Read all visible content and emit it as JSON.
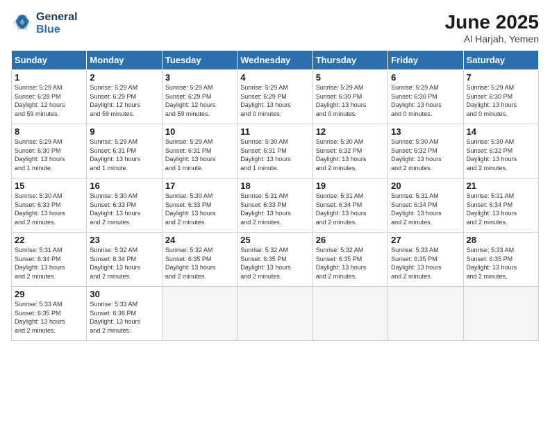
{
  "logo": {
    "line1": "General",
    "line2": "Blue"
  },
  "title": "June 2025",
  "location": "Al Harjah, Yemen",
  "days_of_week": [
    "Sunday",
    "Monday",
    "Tuesday",
    "Wednesday",
    "Thursday",
    "Friday",
    "Saturday"
  ],
  "weeks": [
    [
      {
        "day": "1",
        "info": "Sunrise: 5:29 AM\nSunset: 6:28 PM\nDaylight: 12 hours\nand 59 minutes."
      },
      {
        "day": "2",
        "info": "Sunrise: 5:29 AM\nSunset: 6:29 PM\nDaylight: 12 hours\nand 59 minutes."
      },
      {
        "day": "3",
        "info": "Sunrise: 5:29 AM\nSunset: 6:29 PM\nDaylight: 12 hours\nand 59 minutes."
      },
      {
        "day": "4",
        "info": "Sunrise: 5:29 AM\nSunset: 6:29 PM\nDaylight: 13 hours\nand 0 minutes."
      },
      {
        "day": "5",
        "info": "Sunrise: 5:29 AM\nSunset: 6:30 PM\nDaylight: 13 hours\nand 0 minutes."
      },
      {
        "day": "6",
        "info": "Sunrise: 5:29 AM\nSunset: 6:30 PM\nDaylight: 13 hours\nand 0 minutes."
      },
      {
        "day": "7",
        "info": "Sunrise: 5:29 AM\nSunset: 6:30 PM\nDaylight: 13 hours\nand 0 minutes."
      }
    ],
    [
      {
        "day": "8",
        "info": "Sunrise: 5:29 AM\nSunset: 6:30 PM\nDaylight: 13 hours\nand 1 minute."
      },
      {
        "day": "9",
        "info": "Sunrise: 5:29 AM\nSunset: 6:31 PM\nDaylight: 13 hours\nand 1 minute."
      },
      {
        "day": "10",
        "info": "Sunrise: 5:29 AM\nSunset: 6:31 PM\nDaylight: 13 hours\nand 1 minute."
      },
      {
        "day": "11",
        "info": "Sunrise: 5:30 AM\nSunset: 6:31 PM\nDaylight: 13 hours\nand 1 minute."
      },
      {
        "day": "12",
        "info": "Sunrise: 5:30 AM\nSunset: 6:32 PM\nDaylight: 13 hours\nand 2 minutes."
      },
      {
        "day": "13",
        "info": "Sunrise: 5:30 AM\nSunset: 6:32 PM\nDaylight: 13 hours\nand 2 minutes."
      },
      {
        "day": "14",
        "info": "Sunrise: 5:30 AM\nSunset: 6:32 PM\nDaylight: 13 hours\nand 2 minutes."
      }
    ],
    [
      {
        "day": "15",
        "info": "Sunrise: 5:30 AM\nSunset: 6:33 PM\nDaylight: 13 hours\nand 2 minutes."
      },
      {
        "day": "16",
        "info": "Sunrise: 5:30 AM\nSunset: 6:33 PM\nDaylight: 13 hours\nand 2 minutes."
      },
      {
        "day": "17",
        "info": "Sunrise: 5:30 AM\nSunset: 6:33 PM\nDaylight: 13 hours\nand 2 minutes."
      },
      {
        "day": "18",
        "info": "Sunrise: 5:31 AM\nSunset: 6:33 PM\nDaylight: 13 hours\nand 2 minutes."
      },
      {
        "day": "19",
        "info": "Sunrise: 5:31 AM\nSunset: 6:34 PM\nDaylight: 13 hours\nand 2 minutes."
      },
      {
        "day": "20",
        "info": "Sunrise: 5:31 AM\nSunset: 6:34 PM\nDaylight: 13 hours\nand 2 minutes."
      },
      {
        "day": "21",
        "info": "Sunrise: 5:31 AM\nSunset: 6:34 PM\nDaylight: 13 hours\nand 2 minutes."
      }
    ],
    [
      {
        "day": "22",
        "info": "Sunrise: 5:31 AM\nSunset: 6:34 PM\nDaylight: 13 hours\nand 2 minutes."
      },
      {
        "day": "23",
        "info": "Sunrise: 5:32 AM\nSunset: 6:34 PM\nDaylight: 13 hours\nand 2 minutes."
      },
      {
        "day": "24",
        "info": "Sunrise: 5:32 AM\nSunset: 6:35 PM\nDaylight: 13 hours\nand 2 minutes."
      },
      {
        "day": "25",
        "info": "Sunrise: 5:32 AM\nSunset: 6:35 PM\nDaylight: 13 hours\nand 2 minutes."
      },
      {
        "day": "26",
        "info": "Sunrise: 5:32 AM\nSunset: 6:35 PM\nDaylight: 13 hours\nand 2 minutes."
      },
      {
        "day": "27",
        "info": "Sunrise: 5:33 AM\nSunset: 6:35 PM\nDaylight: 13 hours\nand 2 minutes."
      },
      {
        "day": "28",
        "info": "Sunrise: 5:33 AM\nSunset: 6:35 PM\nDaylight: 13 hours\nand 2 minutes."
      }
    ],
    [
      {
        "day": "29",
        "info": "Sunrise: 5:33 AM\nSunset: 6:35 PM\nDaylight: 13 hours\nand 2 minutes."
      },
      {
        "day": "30",
        "info": "Sunrise: 5:33 AM\nSunset: 6:36 PM\nDaylight: 13 hours\nand 2 minutes."
      },
      {
        "day": "",
        "info": ""
      },
      {
        "day": "",
        "info": ""
      },
      {
        "day": "",
        "info": ""
      },
      {
        "day": "",
        "info": ""
      },
      {
        "day": "",
        "info": ""
      }
    ]
  ]
}
